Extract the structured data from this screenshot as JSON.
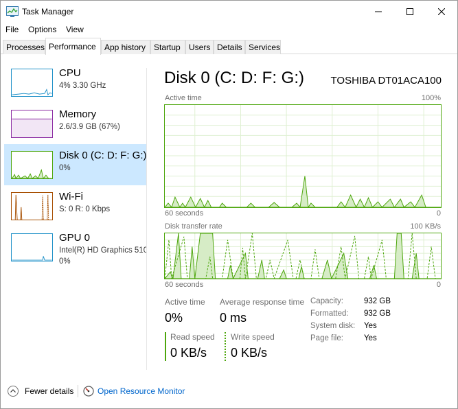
{
  "window": {
    "title": "Task Manager"
  },
  "menu": {
    "file": "File",
    "options": "Options",
    "view": "View"
  },
  "tabs": [
    "Processes",
    "Performance",
    "App history",
    "Startup",
    "Users",
    "Details",
    "Services"
  ],
  "active_tab": "Performance",
  "sidebar": {
    "items": [
      {
        "title": "CPU",
        "subtitle": "4%  3.30 GHz",
        "color": "#1e90c8"
      },
      {
        "title": "Memory",
        "subtitle": "2.6/3.9 GB (67%)",
        "color": "#8b2ba2"
      },
      {
        "title": "Disk 0 (C: D: F: G:)",
        "subtitle": "0%",
        "color": "#4da60c"
      },
      {
        "title": "Wi-Fi",
        "subtitle_prefix": "S: 0  R: 0 Kbps",
        "subtitle": "S: 0  R: 0 Kbps",
        "color": "#a74f01"
      },
      {
        "title": "GPU 0",
        "subtitle": "Intel(R) HD Graphics 510",
        "subtitle2": "0%",
        "color": "#1e90c8"
      }
    ]
  },
  "disk": {
    "title": "Disk 0 (C: D: F: G:)",
    "model": "TOSHIBA DT01ACA100",
    "active_time_graph": {
      "label": "Active time",
      "max": "100%",
      "xlabel": "60 seconds",
      "min": "0"
    },
    "transfer_graph": {
      "label": "Disk transfer rate",
      "max": "100 KB/s",
      "xlabel": "60 seconds",
      "min": "0"
    },
    "stats": {
      "active_time_label": "Active time",
      "active_time_value": "0%",
      "avg_response_label": "Average response time",
      "avg_response_value": "0 ms",
      "read_speed_label": "Read speed",
      "read_speed_value": "0 KB/s",
      "write_speed_label": "Write speed",
      "write_speed_value": "0 KB/s"
    },
    "properties": {
      "capacity_label": "Capacity:",
      "capacity_value": "932 GB",
      "formatted_label": "Formatted:",
      "formatted_value": "932 GB",
      "system_disk_label": "System disk:",
      "system_disk_value": "Yes",
      "page_file_label": "Page file:",
      "page_file_value": "Yes"
    }
  },
  "footer": {
    "fewer_details": "Fewer details",
    "open_resource_monitor": "Open Resource Monitor"
  },
  "colors": {
    "disk_green": "#4da60c",
    "selected_bg": "#cce8ff",
    "link_blue": "#0066cc"
  },
  "icons": {
    "app": "task-manager-icon",
    "minimize": "minimize-icon",
    "maximize": "maximize-icon",
    "close": "close-icon",
    "fewer": "chevron-up-icon",
    "resmon": "resource-monitor-icon"
  }
}
